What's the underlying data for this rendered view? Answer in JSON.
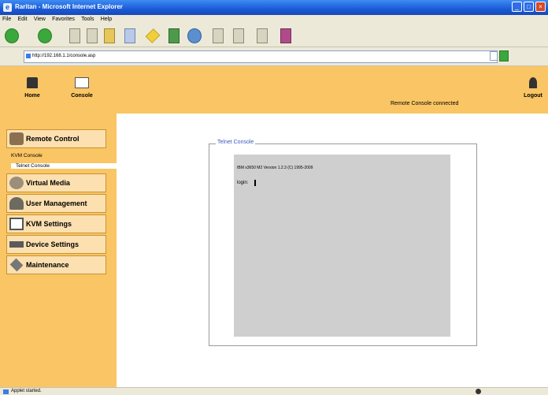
{
  "window": {
    "title": "Raritan - Microsoft Internet Explorer"
  },
  "window_controls": {
    "minimize": "_",
    "maximize": "□",
    "close": "×"
  },
  "menubar": [
    "File",
    "Edit",
    "View",
    "Favorites",
    "Tools",
    "Help"
  ],
  "address": {
    "url": "http://192.168.1.1/console.asp"
  },
  "header": {
    "home_label": "Home",
    "console_label": "Console",
    "status": "Remote Console connected",
    "logout_label": "Logout"
  },
  "sidebar": {
    "items": [
      {
        "label": "Remote Control",
        "icon": "remote-control-icon"
      },
      {
        "label": "Virtual Media",
        "icon": "virtual-media-icon"
      },
      {
        "label": "User Management",
        "icon": "user-management-icon"
      },
      {
        "label": "KVM Settings",
        "icon": "kvm-settings-icon"
      },
      {
        "label": "Device Settings",
        "icon": "device-settings-icon"
      },
      {
        "label": "Maintenance",
        "icon": "maintenance-icon"
      }
    ],
    "subitems": [
      "KVM Console",
      "Telnet Console"
    ]
  },
  "console": {
    "title": "Telnet Console",
    "line1": "IBM x3650 M2 Version 1.2.3 (C) 1995-2009",
    "prompt": "login:"
  },
  "statusbar": {
    "text": "Applet started."
  },
  "colors": {
    "accent": "#fac564",
    "sidebar_button": "#fde0b0",
    "terminal_bg": "#cfcfcf",
    "titlebar": "#1a5bd8"
  }
}
